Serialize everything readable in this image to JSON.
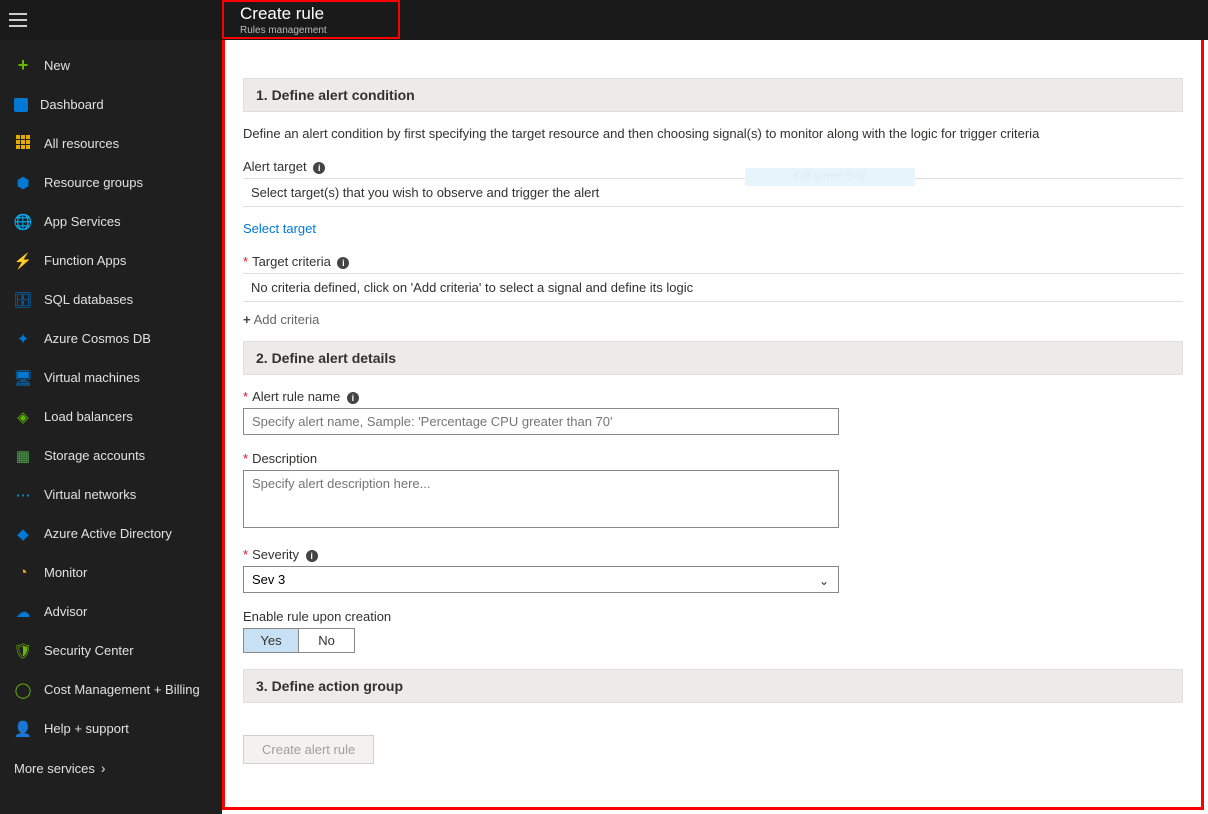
{
  "header": {
    "title": "Create rule",
    "subtitle": "Rules management"
  },
  "snip_badge": "Full-screen Snip",
  "sidebar": {
    "items": [
      {
        "label": "New",
        "iconClass": "plus-icn",
        "glyph": "+"
      },
      {
        "label": "Dashboard",
        "iconClass": "sq",
        "glyph": ""
      },
      {
        "label": "All resources",
        "iconClass": "grid9",
        "glyph": ""
      },
      {
        "label": "Resource groups",
        "iconClass": "cube",
        "glyph": "⬢"
      },
      {
        "label": "App Services",
        "iconClass": "globe",
        "glyph": "🌐"
      },
      {
        "label": "Function Apps",
        "iconClass": "bolt",
        "glyph": "⚡"
      },
      {
        "label": "SQL databases",
        "iconClass": "db",
        "glyph": "🗄"
      },
      {
        "label": "Azure Cosmos DB",
        "iconClass": "cosmos",
        "glyph": "✦"
      },
      {
        "label": "Virtual machines",
        "iconClass": "vm",
        "glyph": "🖥"
      },
      {
        "label": "Load balancers",
        "iconClass": "lb",
        "glyph": "◈"
      },
      {
        "label": "Storage accounts",
        "iconClass": "storage",
        "glyph": "▦"
      },
      {
        "label": "Virtual networks",
        "iconClass": "vnet",
        "glyph": "⋯"
      },
      {
        "label": "Azure Active Directory",
        "iconClass": "aad",
        "glyph": "◆"
      },
      {
        "label": "Monitor",
        "iconClass": "mon",
        "glyph": "◔"
      },
      {
        "label": "Advisor",
        "iconClass": "adv",
        "glyph": "☁"
      },
      {
        "label": "Security Center",
        "iconClass": "sec",
        "glyph": "🛡"
      },
      {
        "label": "Cost Management + Billing",
        "iconClass": "cost",
        "glyph": "◯"
      },
      {
        "label": "Help + support",
        "iconClass": "help",
        "glyph": "👤"
      }
    ],
    "more": "More services",
    "more_chev": "›"
  },
  "section1": {
    "title": "1. Define alert condition",
    "description": "Define an alert condition by first specifying the target resource and then choosing signal(s) to monitor along with the logic for trigger criteria",
    "alert_target_label": "Alert target",
    "alert_target_placeholder": "Select target(s) that you wish to observe and trigger the alert",
    "select_target_link": "Select target",
    "criteria_label": "Target criteria",
    "criteria_placeholder": "No criteria defined, click on 'Add criteria' to select a signal and define its logic",
    "add_criteria": "Add criteria"
  },
  "section2": {
    "title": "2. Define alert details",
    "rule_name_label": "Alert rule name",
    "rule_name_placeholder": "Specify alert name, Sample: 'Percentage CPU greater than 70'",
    "description_label": "Description",
    "description_placeholder": "Specify alert description here...",
    "severity_label": "Severity",
    "severity_value": "Sev 3",
    "enable_label": "Enable rule upon creation",
    "yes": "Yes",
    "no": "No"
  },
  "section3": {
    "title": "3. Define action group"
  },
  "footer": {
    "create_button": "Create alert rule"
  }
}
